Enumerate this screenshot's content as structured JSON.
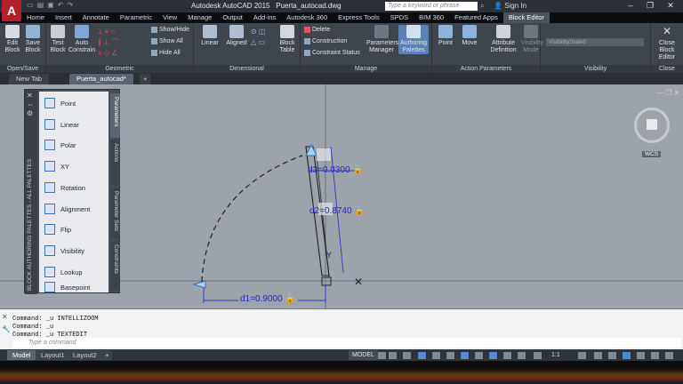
{
  "app": {
    "logo": "A",
    "title": "Autodesk AutoCAD 2015",
    "file": "Puerta_autocad.dwg"
  },
  "search": {
    "placeholder": "Type a keyword or phrase"
  },
  "signin": "Sign In",
  "ribbon_tabs": [
    "Home",
    "Insert",
    "Annotate",
    "Parametric",
    "View",
    "Manage",
    "Output",
    "Add-ins",
    "Autodesk 360",
    "Express Tools",
    "SPDS",
    "BIM 360",
    "Featured Apps",
    "Block Editor"
  ],
  "active_tab": "Block Editor",
  "panels": {
    "open_save": {
      "title": "Open/Save",
      "edit_block": "Edit Block",
      "save_block": "Save Block"
    },
    "geometric": {
      "title": "Geometric",
      "test_block": "Test Block",
      "auto_constrain": "Auto Constrain",
      "show_hide": "Show/Hide",
      "show_all": "Show All",
      "hide_all": "Hide All"
    },
    "dimensional": {
      "title": "Dimensional",
      "linear": "Linear",
      "aligned": "Aligned",
      "block_table": "Block Table"
    },
    "manage": {
      "title": "Manage",
      "delete": "Delete",
      "construction": "Construction",
      "constraint_status": "Constraint Status",
      "parameters_manager": "Parameters Manager",
      "authoring_palettes": "Authoring Palettes"
    },
    "action_parameters": {
      "title": "Action Parameters",
      "point": "Point",
      "move": "Move",
      "attribute_definition": "Attribute Definition"
    },
    "visibility": {
      "title": "Visibility",
      "visibility_state": "VisibilityState0",
      "visibility_mode": "Visibility Mode"
    },
    "close": {
      "title": "Close",
      "close_block_editor": "Close Block Editor"
    }
  },
  "doc_tabs": [
    "New Tab",
    "Puerta_autocad*"
  ],
  "palette": {
    "title": "BLOCK AUTHORING PALETTES - ALL PALETTES",
    "items": [
      "Point",
      "Linear",
      "Polar",
      "XY",
      "Rotation",
      "Alignment",
      "Flip",
      "Visibility",
      "Lookup",
      "Basepoint"
    ],
    "side_tabs": [
      "Parameters",
      "Actions",
      "Parameter Sets",
      "Constraints"
    ]
  },
  "drawing": {
    "d1": "d1=0.9000",
    "d2": "d2=0.8740",
    "d3": "d3=0.0300",
    "y_label": "Y"
  },
  "viewcube": {
    "ucs": "WCS"
  },
  "commands": [
    "Command:  _u INTELLIZOOM",
    "Command:  _u",
    "Command:  _u TEXTEDIT"
  ],
  "cmd_placeholder": "Type a command",
  "layout_tabs": [
    "Model",
    "Layout1",
    "Layout2"
  ],
  "status": {
    "model": "MODEL",
    "scale": "1:1"
  }
}
